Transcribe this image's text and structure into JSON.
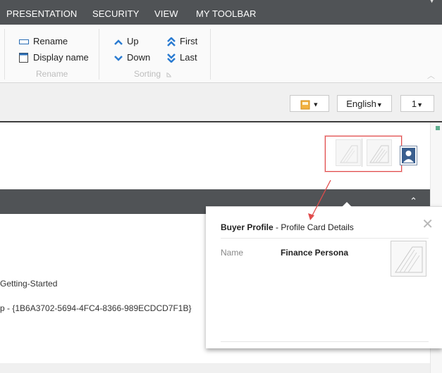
{
  "tabs": [
    "PRESENTATION",
    "SECURITY",
    "VIEW",
    "MY TOOLBAR"
  ],
  "ribbon": {
    "rename_group": {
      "rename_label": "Rename",
      "display_name_label": "Display name",
      "group_label": "Rename"
    },
    "sorting_group": {
      "up_label": "Up",
      "down_label": "Down",
      "first_label": "First",
      "last_label": "Last",
      "group_label": "Sorting"
    }
  },
  "toolbar": {
    "language": "English",
    "version": "1"
  },
  "content": {
    "line1": "Getting-Started",
    "line2": "p - {1B6A3702-5694-4FC4-8366-989ECDCD7F1B}"
  },
  "popup": {
    "title_bold": "Buyer Profile",
    "title_rest": " - Profile Card Details",
    "field_label": "Name",
    "field_value": "Finance Persona"
  },
  "colors": {
    "tabbar": "#505356",
    "accent_red": "#e14b4b",
    "ribbon_blue": "#2a7bd1"
  },
  "icons": [
    "rename-icon",
    "display-name-icon",
    "up-icon",
    "down-icon",
    "first-icon",
    "last-icon",
    "dialog-launcher-icon",
    "collapse-ribbon-icon",
    "close-icon",
    "user-icon",
    "scroll-up-icon"
  ]
}
